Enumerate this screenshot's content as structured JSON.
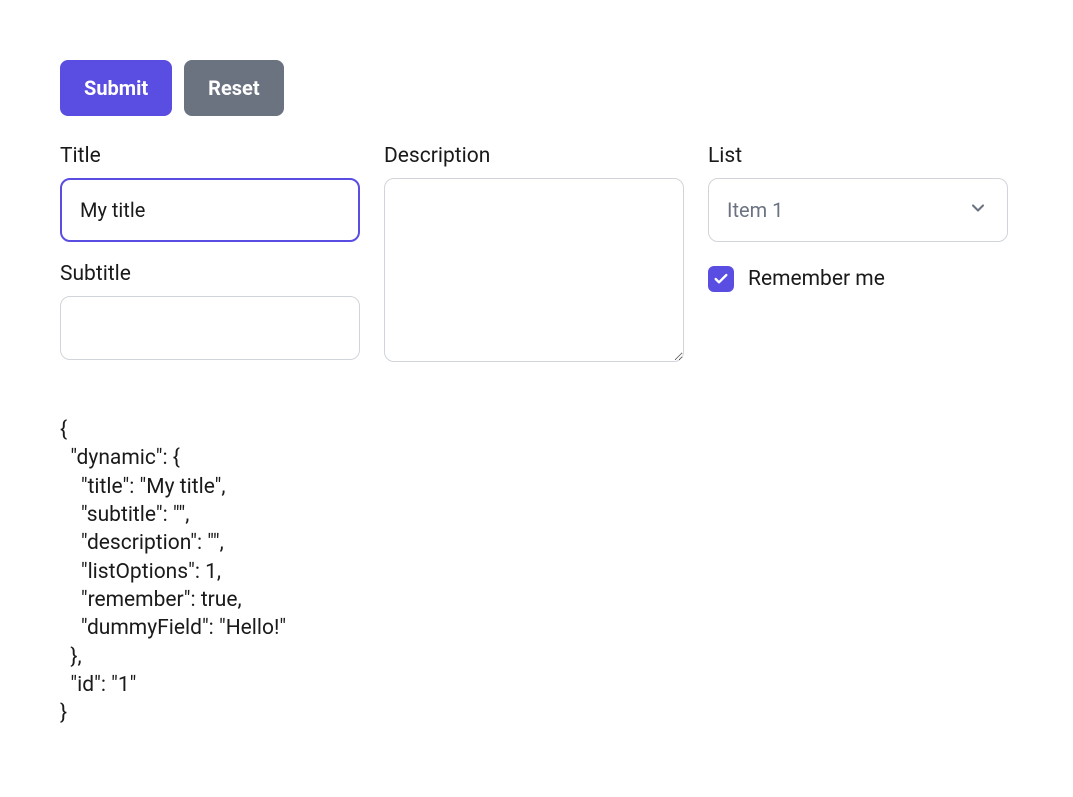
{
  "buttons": {
    "submit": "Submit",
    "reset": "Reset"
  },
  "fields": {
    "title": {
      "label": "Title",
      "value": "My title"
    },
    "subtitle": {
      "label": "Subtitle",
      "value": ""
    },
    "description": {
      "label": "Description",
      "value": ""
    },
    "list": {
      "label": "List",
      "selected": "Item 1"
    },
    "remember": {
      "label": "Remember me",
      "checked": true
    }
  },
  "json_output": "{\n  \"dynamic\": {\n    \"title\": \"My title\",\n    \"subtitle\": \"\",\n    \"description\": \"\",\n    \"listOptions\": 1,\n    \"remember\": true,\n    \"dummyField\": \"Hello!\"\n  },\n  \"id\": \"1\"\n}"
}
